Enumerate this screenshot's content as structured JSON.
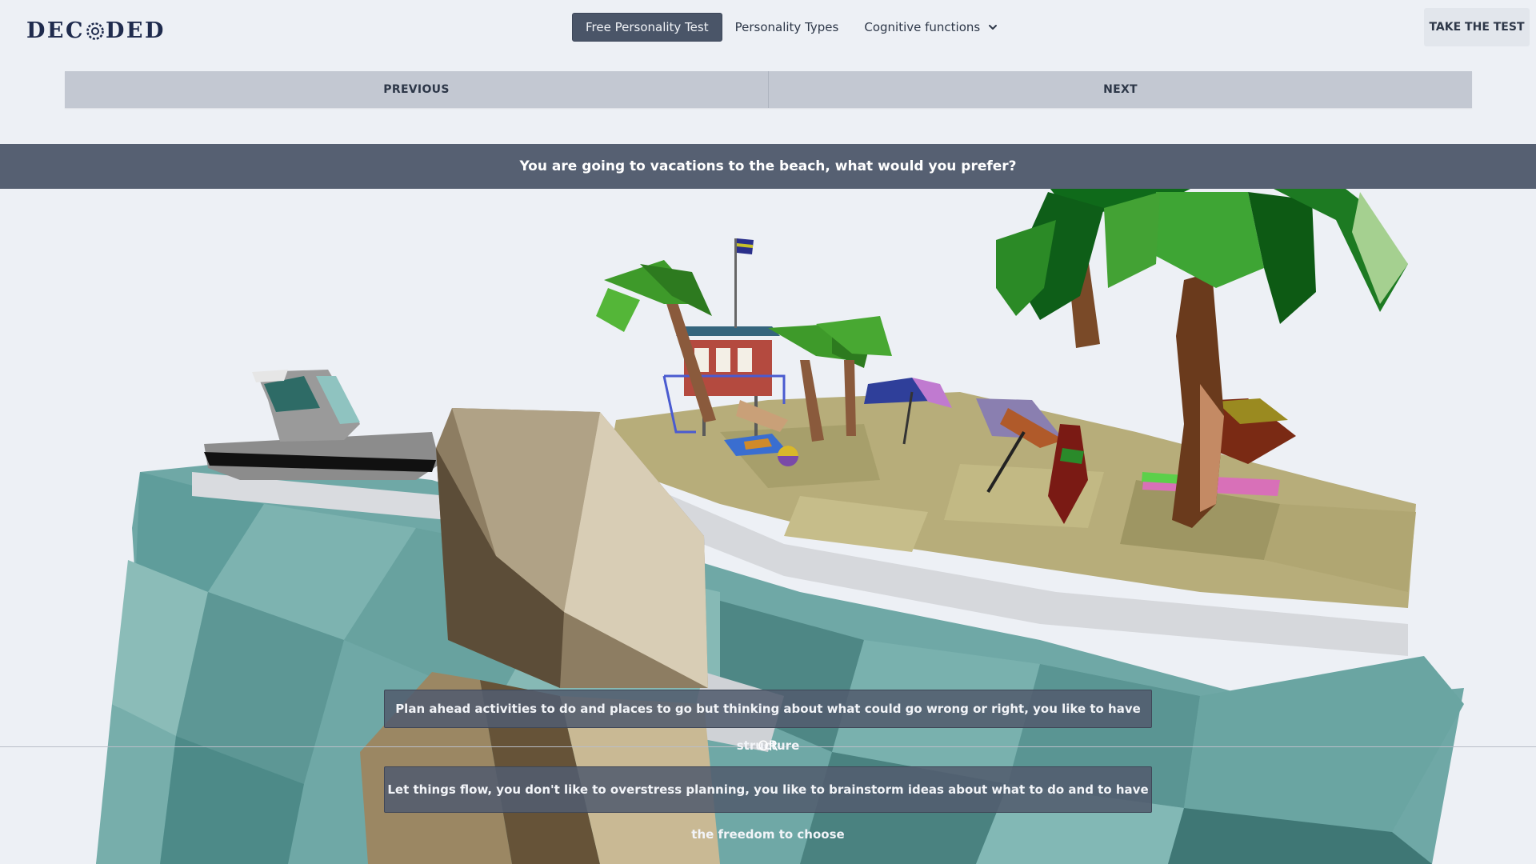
{
  "header": {
    "logo": {
      "part1": "DEC",
      "part2": "DED"
    },
    "nav": [
      {
        "label": "Free Personality Test",
        "active": true
      },
      {
        "label": "Personality Types",
        "active": false
      },
      {
        "label": "Cognitive functions",
        "active": false,
        "icon": "chevron-down-icon"
      }
    ],
    "cta_label": "TAKE THE TEST"
  },
  "pager": {
    "previous_label": "PREVIOUS",
    "next_label": "NEXT"
  },
  "question": {
    "text": "You are going to vacations to the beach, what would you prefer?",
    "options": [
      "Plan ahead activities to do and places to go but thinking about what could go wrong or right, you like to have structure",
      "Let things flow, you don't like to overstress planning, you like to brainstorm ideas about what to do and to have the freedom to choose"
    ],
    "or_label": "OR"
  },
  "colors": {
    "background": "#edf0f5",
    "question_bar": "#566072",
    "active_nav": "#4a5568",
    "pager": "#c3c8d2",
    "water": "#6fa8a6",
    "sand": "#b7ad7a"
  }
}
